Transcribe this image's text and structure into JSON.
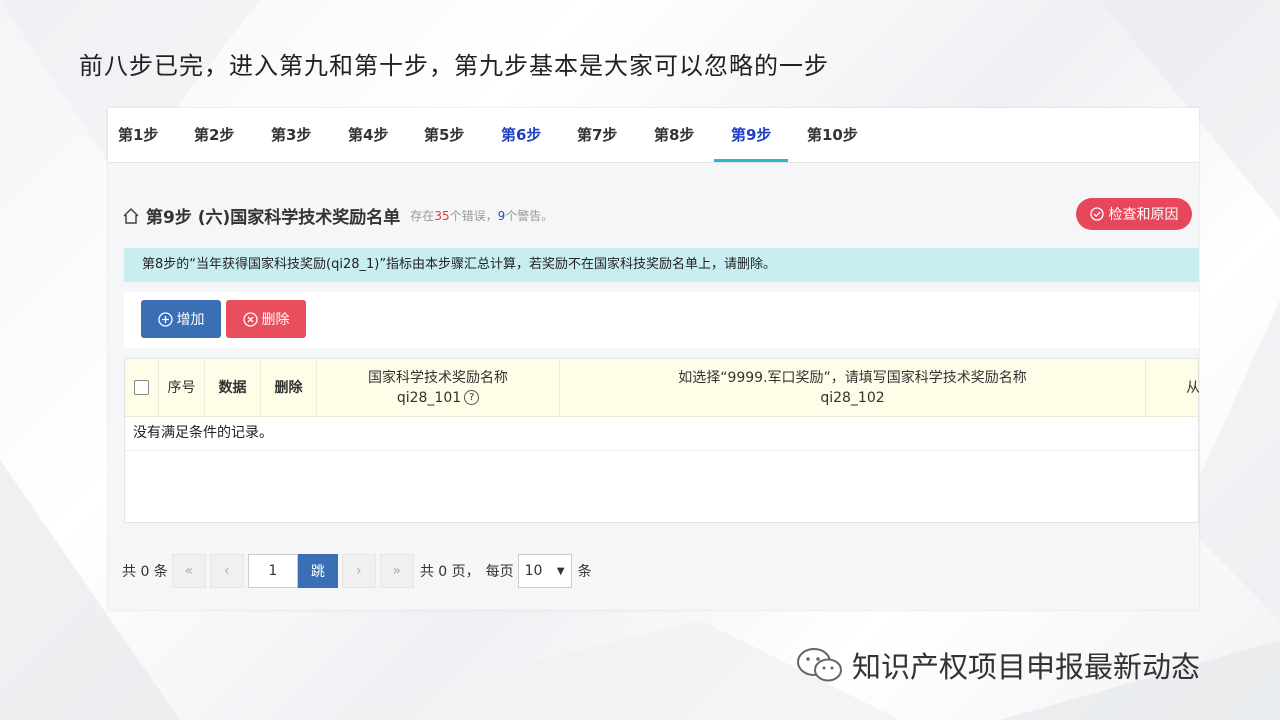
{
  "slide_title": "前八步已完，进入第九和第十步，第九步基本是大家可以忽略的一步",
  "steps": [
    "第1步",
    "第2步",
    "第3步",
    "第4步",
    "第5步",
    "第6步",
    "第7步",
    "第8步",
    "第9步",
    "第10步"
  ],
  "active_step": "第9步",
  "header": {
    "title": "第9步 (六)国家科学技术奖励名单",
    "sub_prefix": "存在",
    "error_count": "35",
    "sub_mid": "个错误，",
    "warning_count": "9",
    "sub_suffix": "个警告。"
  },
  "check_button": "检查和原因",
  "notice": "第8步的“当年获得国家科技奖励(qi28_1)”指标由本步骤汇总计算，若奖励不在国家科技奖励名单上，请删除。",
  "toolbar": {
    "add_label": "增加",
    "delete_label": "删除"
  },
  "table": {
    "columns": {
      "index": "序号",
      "data": "数据",
      "delete": "删除",
      "award_name": "国家科学技术奖励名称",
      "award_name_code": "qi28_101",
      "other_name": "如选择“9999.军口奖励”，请填写国家科学技术奖励名称",
      "other_name_code": "qi28_102",
      "next": "从"
    },
    "empty_text": "没有满足条件的记录。"
  },
  "pager": {
    "total_prefix": "共 0 条",
    "first": "«",
    "prev": "‹",
    "page_value": "1",
    "go": "跳",
    "next": "›",
    "last": "»",
    "pages_text": "共 0 页，",
    "per_page_label": "每页",
    "per_page_value": "10",
    "unit": "条"
  },
  "footer": {
    "text": "知识产权项目申报最新动态",
    "icon": "wechat-icon"
  },
  "colors": {
    "accent": "#2fb5c8",
    "primary": "#3a6fb5",
    "danger": "#e84e5b",
    "notice_bg": "#c9eef2"
  }
}
